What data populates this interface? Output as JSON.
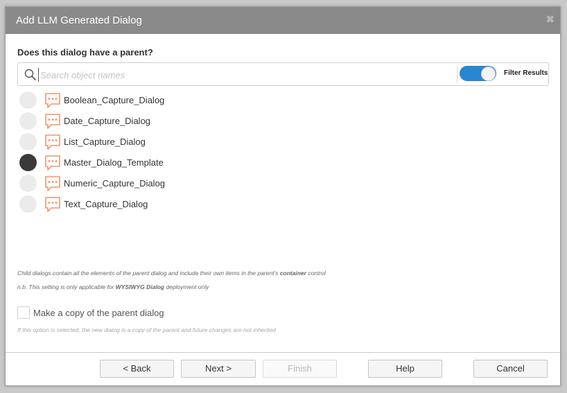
{
  "dialog": {
    "title": "Add LLM Generated Dialog",
    "close_glyph": "✖"
  },
  "question": "Does this dialog have a parent?",
  "search": {
    "placeholder": "Search object names",
    "filter_label": "Filter Results",
    "filter_enabled": true
  },
  "items": [
    {
      "label": "Boolean_Capture_Dialog",
      "selected": false,
      "icon": "chat-bubble-icon"
    },
    {
      "label": "Date_Capture_Dialog",
      "selected": false,
      "icon": "chat-bubble-icon"
    },
    {
      "label": "List_Capture_Dialog",
      "selected": false,
      "icon": "chat-bubble-icon"
    },
    {
      "label": "Master_Dialog_Template",
      "selected": true,
      "icon": "chat-bubble-icon"
    },
    {
      "label": "Numeric_Capture_Dialog",
      "selected": false,
      "icon": "chat-bubble-icon"
    },
    {
      "label": "Text_Capture_Dialog",
      "selected": false,
      "icon": "chat-bubble-icon"
    }
  ],
  "notes": {
    "child_pre": "Child dialogs contain all the elements of the parent dialog and include their own items in the parent's ",
    "child_bold": "container",
    "child_post": " control",
    "nb_pre": "n.b. This setting is only applicable for ",
    "nb_bold": "WYSIWYG Dialog",
    "nb_post": " deployment only"
  },
  "copy": {
    "label": "Make a copy of the parent dialog",
    "checked": false,
    "hint": "If this option is selected, the new dialog is a copy of the parent and future changes are not inherited"
  },
  "buttons": {
    "back": "< Back",
    "next": "Next >",
    "finish": "Finish",
    "help": "Help",
    "cancel": "Cancel"
  },
  "colors": {
    "accent": "#2a86d1",
    "icon_orange": "#f0956a",
    "titlebar": "#8a8a8a",
    "selected_radio": "#3a3a3a"
  }
}
